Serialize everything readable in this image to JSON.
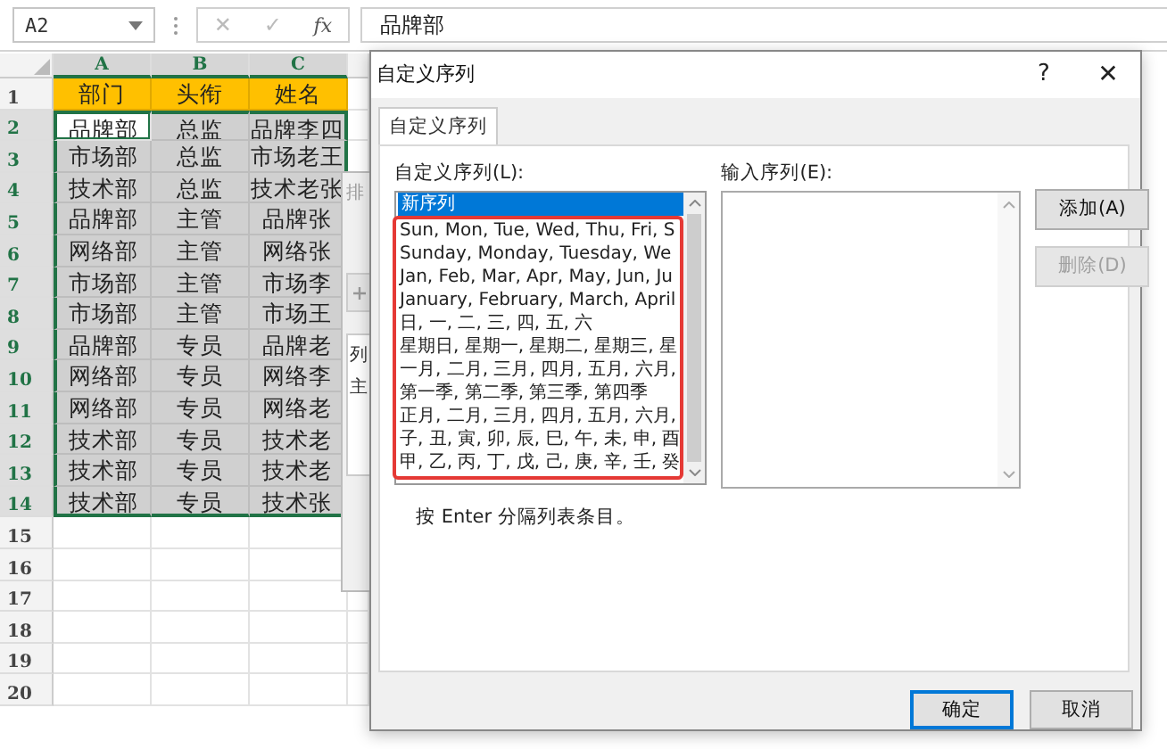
{
  "formula_bar": {
    "name_box": "A2",
    "cancel": "✕",
    "enter": "✓",
    "fx": "fx",
    "value": "品牌部"
  },
  "sheet": {
    "columns": [
      {
        "label": "A",
        "selected": true
      },
      {
        "label": "B",
        "selected": true
      },
      {
        "label": "C",
        "selected": true
      }
    ],
    "rows": [
      {
        "number": "1",
        "selected": false,
        "kind": "header",
        "cells": [
          {
            "text": "部门",
            "active": false
          },
          {
            "text": "头衔",
            "active": false
          },
          {
            "text": "姓名",
            "active": false
          }
        ]
      },
      {
        "number": "2",
        "selected": true,
        "kind": "data",
        "cells": [
          {
            "text": "品牌部",
            "active": true
          },
          {
            "text": "总监",
            "active": false
          },
          {
            "text": "品牌李四",
            "active": false
          }
        ]
      },
      {
        "number": "3",
        "selected": true,
        "kind": "data",
        "cells": [
          {
            "text": "市场部",
            "active": false
          },
          {
            "text": "总监",
            "active": false
          },
          {
            "text": "市场老王",
            "active": false
          }
        ]
      },
      {
        "number": "4",
        "selected": true,
        "kind": "data",
        "cells": [
          {
            "text": "技术部",
            "active": false
          },
          {
            "text": "总监",
            "active": false
          },
          {
            "text": "技术老张",
            "active": false
          }
        ]
      },
      {
        "number": "5",
        "selected": true,
        "kind": "data",
        "cells": [
          {
            "text": "品牌部",
            "active": false
          },
          {
            "text": "主管",
            "active": false
          },
          {
            "text": "品牌张",
            "active": false
          }
        ]
      },
      {
        "number": "6",
        "selected": true,
        "kind": "data",
        "cells": [
          {
            "text": "网络部",
            "active": false
          },
          {
            "text": "主管",
            "active": false
          },
          {
            "text": "网络张",
            "active": false
          }
        ]
      },
      {
        "number": "7",
        "selected": true,
        "kind": "data",
        "cells": [
          {
            "text": "市场部",
            "active": false
          },
          {
            "text": "主管",
            "active": false
          },
          {
            "text": "市场李",
            "active": false
          }
        ]
      },
      {
        "number": "8",
        "selected": true,
        "kind": "data",
        "cells": [
          {
            "text": "市场部",
            "active": false
          },
          {
            "text": "主管",
            "active": false
          },
          {
            "text": "市场王",
            "active": false
          }
        ]
      },
      {
        "number": "9",
        "selected": true,
        "kind": "data",
        "cells": [
          {
            "text": "品牌部",
            "active": false
          },
          {
            "text": "专员",
            "active": false
          },
          {
            "text": "品牌老",
            "active": false
          }
        ]
      },
      {
        "number": "10",
        "selected": true,
        "kind": "data",
        "cells": [
          {
            "text": "网络部",
            "active": false
          },
          {
            "text": "专员",
            "active": false
          },
          {
            "text": "网络李",
            "active": false
          }
        ]
      },
      {
        "number": "11",
        "selected": true,
        "kind": "data",
        "cells": [
          {
            "text": "网络部",
            "active": false
          },
          {
            "text": "专员",
            "active": false
          },
          {
            "text": "网络老",
            "active": false
          }
        ]
      },
      {
        "number": "12",
        "selected": true,
        "kind": "data",
        "cells": [
          {
            "text": "技术部",
            "active": false
          },
          {
            "text": "专员",
            "active": false
          },
          {
            "text": "技术老",
            "active": false
          }
        ]
      },
      {
        "number": "13",
        "selected": true,
        "kind": "data",
        "cells": [
          {
            "text": "技术部",
            "active": false
          },
          {
            "text": "专员",
            "active": false
          },
          {
            "text": "技术老",
            "active": false
          }
        ]
      },
      {
        "number": "14",
        "selected": true,
        "kind": "data",
        "cells": [
          {
            "text": "技术部",
            "active": false
          },
          {
            "text": "专员",
            "active": false
          },
          {
            "text": "技术张",
            "active": false
          }
        ]
      },
      {
        "number": "15",
        "selected": false,
        "kind": "empty",
        "cells": []
      },
      {
        "number": "16",
        "selected": false,
        "kind": "empty",
        "cells": []
      },
      {
        "number": "17",
        "selected": false,
        "kind": "empty",
        "cells": []
      },
      {
        "number": "18",
        "selected": false,
        "kind": "empty",
        "cells": []
      },
      {
        "number": "19",
        "selected": false,
        "kind": "empty",
        "cells": []
      },
      {
        "number": "20",
        "selected": false,
        "kind": "empty",
        "cells": []
      }
    ]
  },
  "background_dialog": {
    "title": "排",
    "column_header": "列",
    "row_text": "主"
  },
  "dialog": {
    "title": "自定义序列",
    "help": "?",
    "close": "✕",
    "tabs": [
      {
        "label": "自定义序列",
        "selected": true
      }
    ],
    "list_label": "自定义序列(L):",
    "list_items": [
      {
        "text": "新序列",
        "selected": true
      },
      {
        "text": "Sun, Mon, Tue, Wed, Thu, Fri, S",
        "selected": false
      },
      {
        "text": "Sunday, Monday, Tuesday, We",
        "selected": false
      },
      {
        "text": "Jan, Feb, Mar, Apr, May, Jun, Ju",
        "selected": false
      },
      {
        "text": "January, February, March, April",
        "selected": false
      },
      {
        "text": "日, 一, 二, 三, 四, 五, 六",
        "selected": false
      },
      {
        "text": "星期日, 星期一, 星期二, 星期三, 星",
        "selected": false
      },
      {
        "text": "一月, 二月, 三月, 四月, 五月, 六月,",
        "selected": false
      },
      {
        "text": "第一季, 第二季, 第三季, 第四季",
        "selected": false
      },
      {
        "text": "正月, 二月, 三月, 四月, 五月, 六月,",
        "selected": false
      },
      {
        "text": "子, 丑, 寅, 卯, 辰, 巳, 午, 未, 申, 酉",
        "selected": false
      },
      {
        "text": "甲, 乙, 丙, 丁, 戊, 己, 庚, 辛, 壬, 癸",
        "selected": false
      }
    ],
    "input_label": "输入序列(E):",
    "buttons": [
      {
        "label": "添加(A)",
        "disabled": false
      },
      {
        "label": "删除(D)",
        "disabled": true
      }
    ],
    "hint": "按 Enter 分隔列表条目。",
    "footer_buttons": [
      {
        "label": "确定",
        "default": true
      },
      {
        "label": "取消",
        "default": false
      }
    ]
  }
}
